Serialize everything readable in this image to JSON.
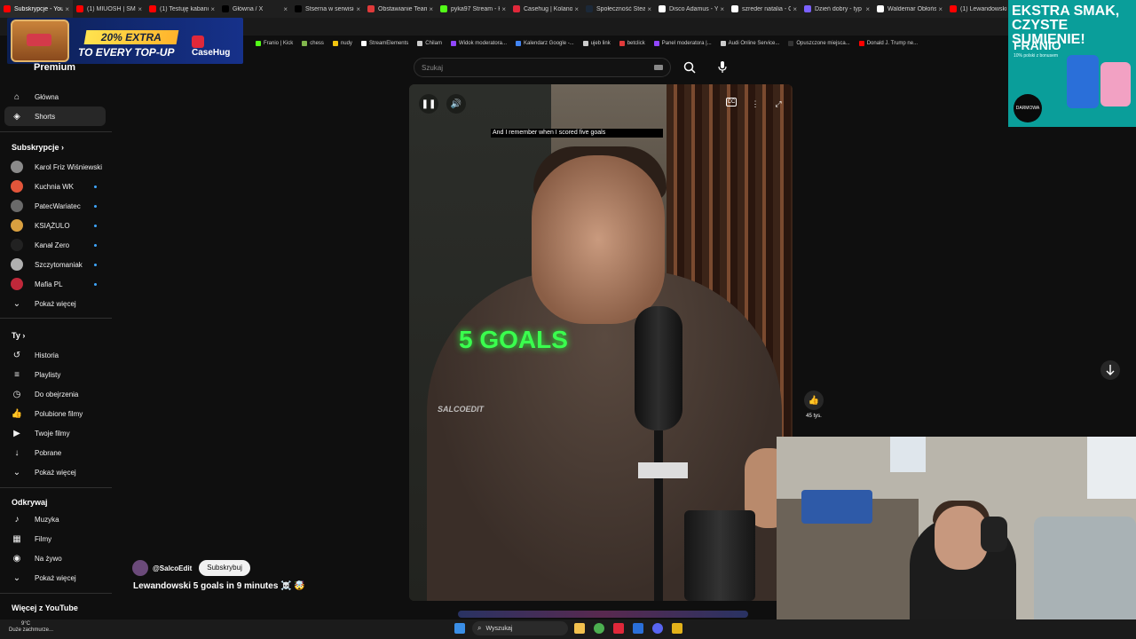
{
  "tabs": [
    {
      "label": "Subskrypcje - YouTube",
      "color": "#ff0000"
    },
    {
      "label": "(1) MIUOSH | SMUGGLERS",
      "color": "#ff0000"
    },
    {
      "label": "(1) Testuję kabanosy",
      "color": "#ff0000"
    },
    {
      "label": "Główna / X",
      "color": "#000000"
    },
    {
      "label": "Stserna w serwisie",
      "color": "#000000"
    },
    {
      "label": "Obstawianie Team",
      "color": "#e03a3a"
    },
    {
      "label": "pyka97 Stream - Kick",
      "color": "#53fc18"
    },
    {
      "label": "Casehug | Kolano",
      "color": "#e0283a"
    },
    {
      "label": "Społeczność Steam",
      "color": "#1b2838"
    },
    {
      "label": "Disco Adamus - YouTube",
      "color": "#ffffff"
    },
    {
      "label": "szreder natalia - Google",
      "color": "#ffffff"
    },
    {
      "label": "Dzień dobry - typ",
      "color": "#7b61ff"
    },
    {
      "label": "Waldemar Obłoński",
      "color": "#ffffff"
    },
    {
      "label": "(1) Lewandowski",
      "color": "#ff0000"
    }
  ],
  "bookmarks": [
    {
      "label": "Franio | Kick",
      "color": "#53fc18"
    },
    {
      "label": "chess",
      "color": "#81b64c"
    },
    {
      "label": "nudy",
      "color": "#f1c40f"
    },
    {
      "label": "StreamElements",
      "color": "#ffffff"
    },
    {
      "label": "Chilam",
      "color": "#cccccc"
    },
    {
      "label": "Widok moderatora...",
      "color": "#9146ff"
    },
    {
      "label": "Kalendarz Google -...",
      "color": "#4285f4"
    },
    {
      "label": "ujeb link",
      "color": "#cccccc"
    },
    {
      "label": "betclick",
      "color": "#e03a3a"
    },
    {
      "label": "Panel moderatora |...",
      "color": "#9146ff"
    },
    {
      "label": "Audi Online Service...",
      "color": "#cccccc"
    },
    {
      "label": "Opuszczone miejsca...",
      "color": "#333333"
    },
    {
      "label": "Donald J. Trump ne...",
      "color": "#ff0000"
    }
  ],
  "promo": {
    "extra": "20% EXTRA",
    "topup": "TO EVERY TOP-UP",
    "brand": "CaseHug"
  },
  "ad": {
    "headline": "EKSTRA SMAK, CZYSTE SUMIENIE!",
    "brand": "FRANIO",
    "small": "10% polski z bonusem",
    "circle": "DARMOWA WYSYŁKA"
  },
  "logo": {
    "text": "Premium"
  },
  "search": {
    "placeholder": "Szukaj"
  },
  "sidebar": {
    "main": [
      {
        "label": "Główna",
        "icon": "home-icon",
        "glyph": "⌂",
        "selected": false
      },
      {
        "label": "Shorts",
        "icon": "shorts-icon",
        "glyph": "◈",
        "selected": true
      }
    ],
    "subs_title": "Subskrypcje",
    "subs": [
      {
        "label": "Karol Friz Wiśniewski",
        "color": "#8a8a8a",
        "dot": false
      },
      {
        "label": "Kuchnia WK",
        "color": "#e2553a",
        "dot": true
      },
      {
        "label": "PatecWariatec",
        "color": "#6a6a6a",
        "dot": true
      },
      {
        "label": "KSIĄŻULO",
        "color": "#d9a040",
        "dot": true
      },
      {
        "label": "Kanał Zero",
        "color": "#222222",
        "dot": true
      },
      {
        "label": "Szczytomaniak",
        "color": "#b0b0b0",
        "dot": true
      },
      {
        "label": "Mafia PL",
        "color": "#c0283a",
        "dot": true
      }
    ],
    "more1": "Pokaż więcej",
    "you_title": "Ty",
    "you": [
      {
        "label": "Historia",
        "icon": "history-icon",
        "glyph": "↺"
      },
      {
        "label": "Playlisty",
        "icon": "playlists-icon",
        "glyph": "≡"
      },
      {
        "label": "Do obejrzenia",
        "icon": "watch-later-icon",
        "glyph": "◷"
      },
      {
        "label": "Polubione filmy",
        "icon": "liked-icon",
        "glyph": "👍"
      },
      {
        "label": "Twoje filmy",
        "icon": "your-videos-icon",
        "glyph": "▶"
      },
      {
        "label": "Pobrane",
        "icon": "download-icon",
        "glyph": "↓"
      }
    ],
    "more2": "Pokaż więcej",
    "explore_title": "Odkrywaj",
    "explore": [
      {
        "label": "Muzyka",
        "icon": "music-icon",
        "glyph": "♪"
      },
      {
        "label": "Filmy",
        "icon": "movies-icon",
        "glyph": "▦"
      },
      {
        "label": "Na żywo",
        "icon": "live-icon",
        "glyph": "◉"
      }
    ],
    "more3": "Pokaż więcej",
    "more_yt": "Więcej z YouTube"
  },
  "video": {
    "caption": "And I remember when I scored five goals",
    "overlay": "5 GOALS",
    "watermark": "SALCOEDIT",
    "like_count": "45 tys."
  },
  "channel": {
    "name": "@SalcoEdit",
    "subscribe": "Subskrybuj"
  },
  "title": "Lewandowski 5 goals in 9 minutes ☠️ 🤯",
  "taskbar": {
    "weather_temp": "9°C",
    "weather_desc": "Duże zachmurze...",
    "search": "Wyszukaj"
  }
}
